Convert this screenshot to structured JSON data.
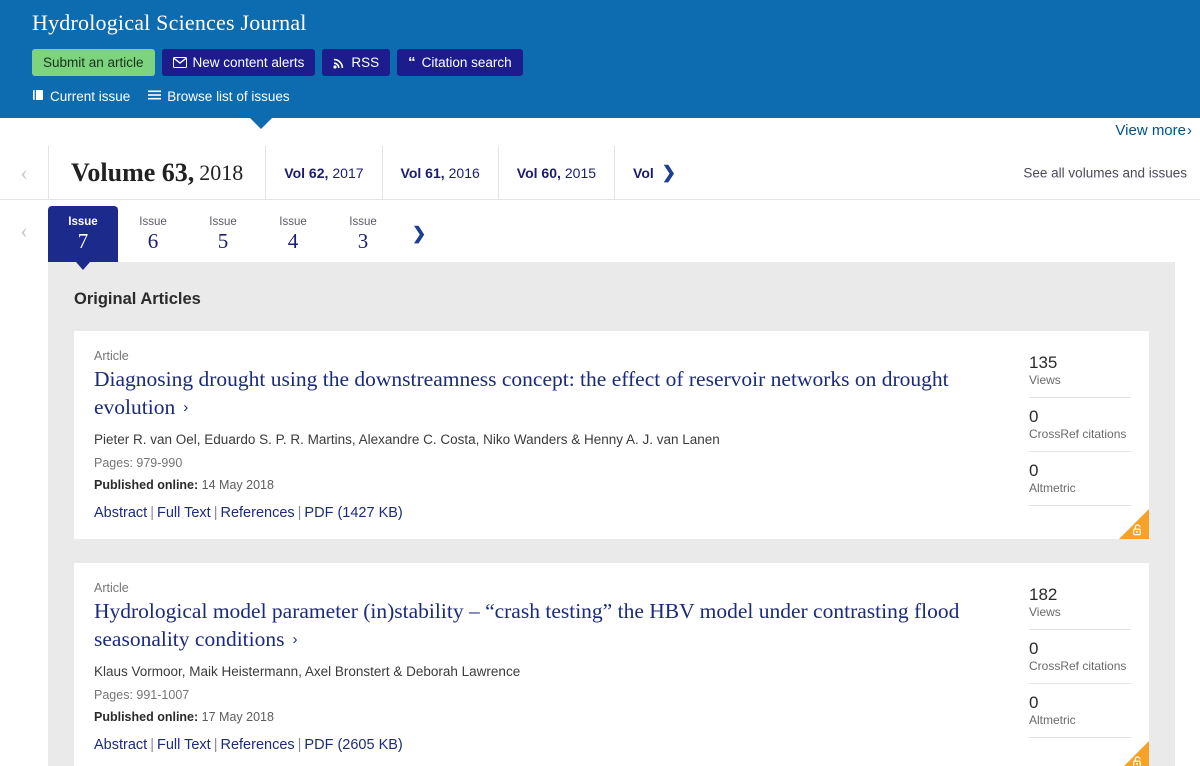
{
  "header": {
    "title": "Hydrological Sciences Journal",
    "buttons": [
      {
        "label": "Submit an article",
        "style": "green",
        "icon": ""
      },
      {
        "label": "New content alerts",
        "style": "navy",
        "icon": "envelope-icon"
      },
      {
        "label": "RSS",
        "style": "navy",
        "icon": "rss-icon"
      },
      {
        "label": "Citation search",
        "style": "navy",
        "icon": "quote-icon"
      }
    ],
    "links": [
      {
        "label": "Current issue",
        "icon": "book-icon"
      },
      {
        "label": "Browse list of issues",
        "icon": "list-icon"
      }
    ],
    "background_color": "#0d6cb0",
    "submit_button_color": "#7ed37e",
    "nav_button_color": "#1c1c8c"
  },
  "view_more": {
    "label": "View more",
    "chevron": "›"
  },
  "volumes": {
    "prev_arrow": "‹",
    "next_arrow": "❯",
    "see_all_label": "See all volumes and issues",
    "current": {
      "prefix": "Volume 63,",
      "year": "2018"
    },
    "items": [
      {
        "num": "Vol 62,",
        "year": "2017"
      },
      {
        "num": "Vol 61,",
        "year": "2016"
      },
      {
        "num": "Vol 60,",
        "year": "2015"
      },
      {
        "num": "Vol",
        "year": ""
      }
    ]
  },
  "issues": {
    "prev_arrow": "‹",
    "next_arrow": "❯",
    "word": "Issue",
    "items": [
      {
        "number": "7",
        "active": true
      },
      {
        "number": "6",
        "active": false
      },
      {
        "number": "5",
        "active": false
      },
      {
        "number": "4",
        "active": false
      },
      {
        "number": "3",
        "active": false
      }
    ]
  },
  "section": {
    "heading": "Original Articles"
  },
  "articles": [
    {
      "type": "Article",
      "title": "Diagnosing drought using the downstreamness concept: the effect of reservoir networks on drought evolution",
      "title_chevron": "›",
      "authors": "Pieter R. van Oel, Eduardo S. P. R. Martins, Alexandre C. Costa, Niko Wanders & Henny A. J. van Lanen",
      "pages_label": "Pages:",
      "pages_value": "979-990",
      "published_label": "Published online:",
      "published_value": "14 May 2018",
      "links": [
        "Abstract",
        "Full Text",
        "References",
        "PDF (1427 KB)"
      ],
      "metrics": [
        {
          "value": "135",
          "label": "Views"
        },
        {
          "value": "0",
          "label": "CrossRef citations"
        },
        {
          "value": "0",
          "label": "Altmetric"
        }
      ],
      "open_access": true,
      "open_access_color": "#f7a227"
    },
    {
      "type": "Article",
      "title": "Hydrological model parameter (in)stability – “crash testing” the HBV model under contrasting flood seasonality conditions",
      "title_chevron": "›",
      "authors": "Klaus Vormoor, Maik Heistermann, Axel Bronstert & Deborah Lawrence",
      "pages_label": "Pages:",
      "pages_value": "991-1007",
      "published_label": "Published online:",
      "published_value": "17 May 2018",
      "links": [
        "Abstract",
        "Full Text",
        "References",
        "PDF (2605 KB)"
      ],
      "metrics": [
        {
          "value": "182",
          "label": "Views"
        },
        {
          "value": "0",
          "label": "CrossRef citations"
        },
        {
          "value": "0",
          "label": "Altmetric"
        }
      ],
      "open_access": true,
      "open_access_color": "#f7a227"
    }
  ]
}
